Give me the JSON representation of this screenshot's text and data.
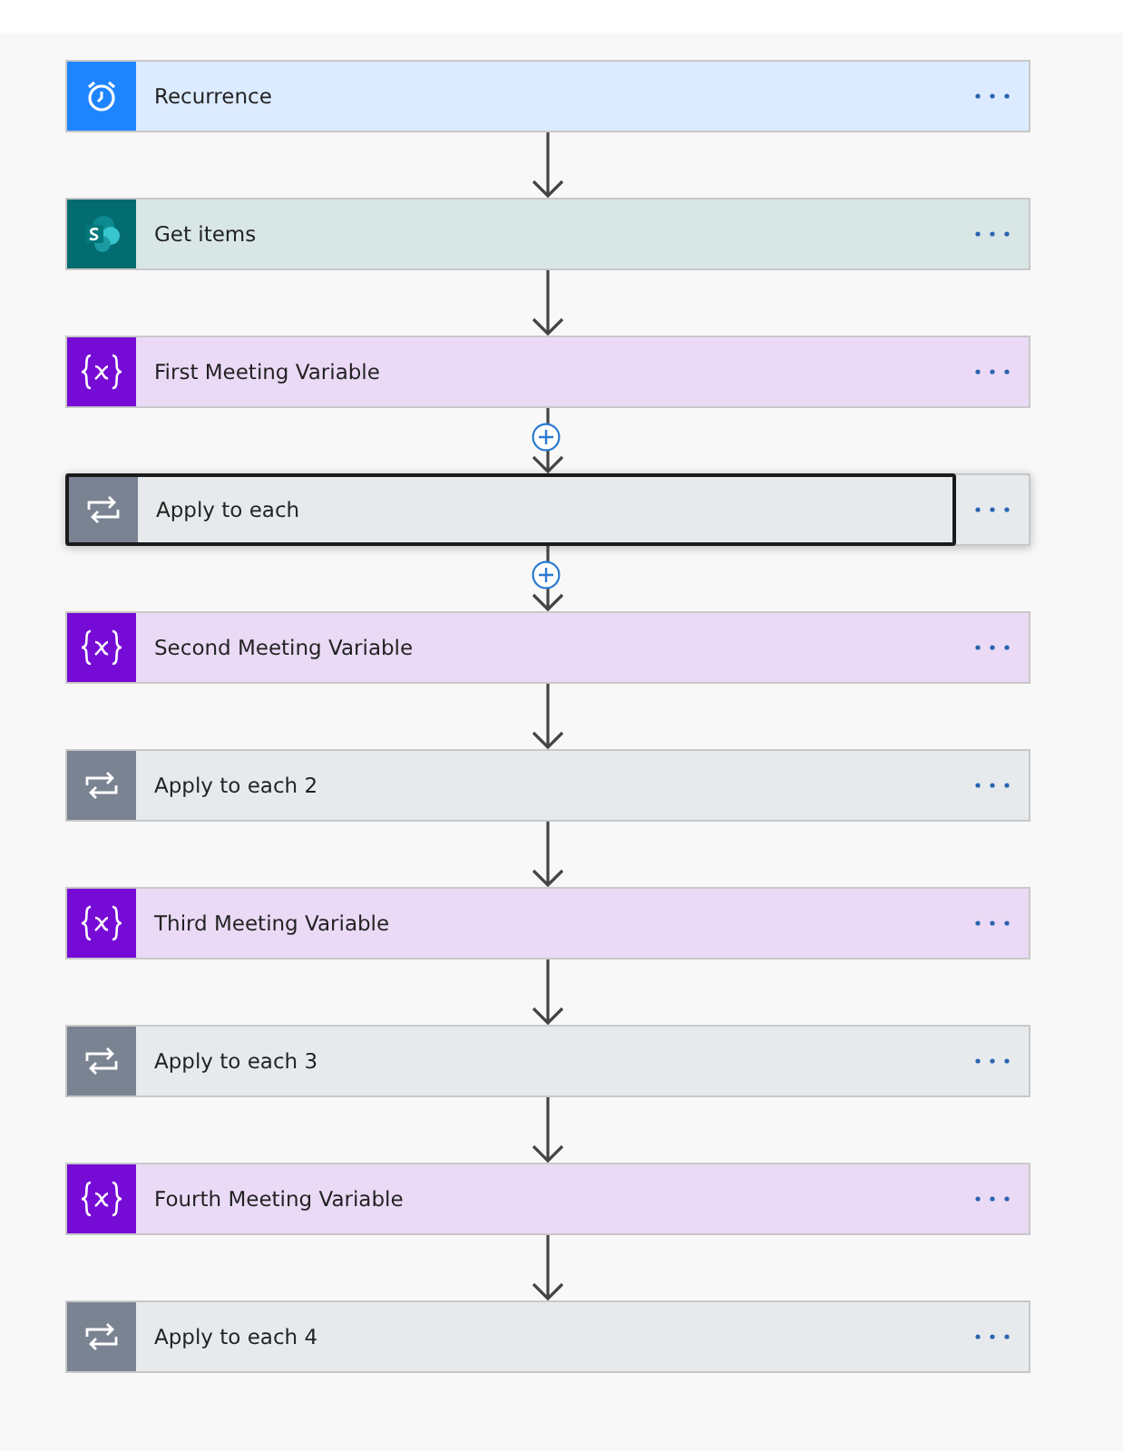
{
  "steps": [
    {
      "kind": "recurrence",
      "title": "Recurrence",
      "selected": false
    },
    {
      "kind": "sharepoint",
      "title": "Get items",
      "selected": false
    },
    {
      "kind": "variable",
      "title": "First Meeting Variable",
      "selected": false
    },
    {
      "kind": "loop",
      "title": "Apply to each",
      "selected": true,
      "add_button": true
    },
    {
      "kind": "variable",
      "title": "Second Meeting Variable",
      "selected": false,
      "add_button": true
    },
    {
      "kind": "loop",
      "title": "Apply to each 2",
      "selected": false
    },
    {
      "kind": "variable",
      "title": "Third Meeting Variable",
      "selected": false
    },
    {
      "kind": "loop",
      "title": "Apply to each 3",
      "selected": false
    },
    {
      "kind": "variable",
      "title": "Fourth Meeting Variable",
      "selected": false
    },
    {
      "kind": "loop",
      "title": "Apply to each 4",
      "selected": false
    }
  ]
}
